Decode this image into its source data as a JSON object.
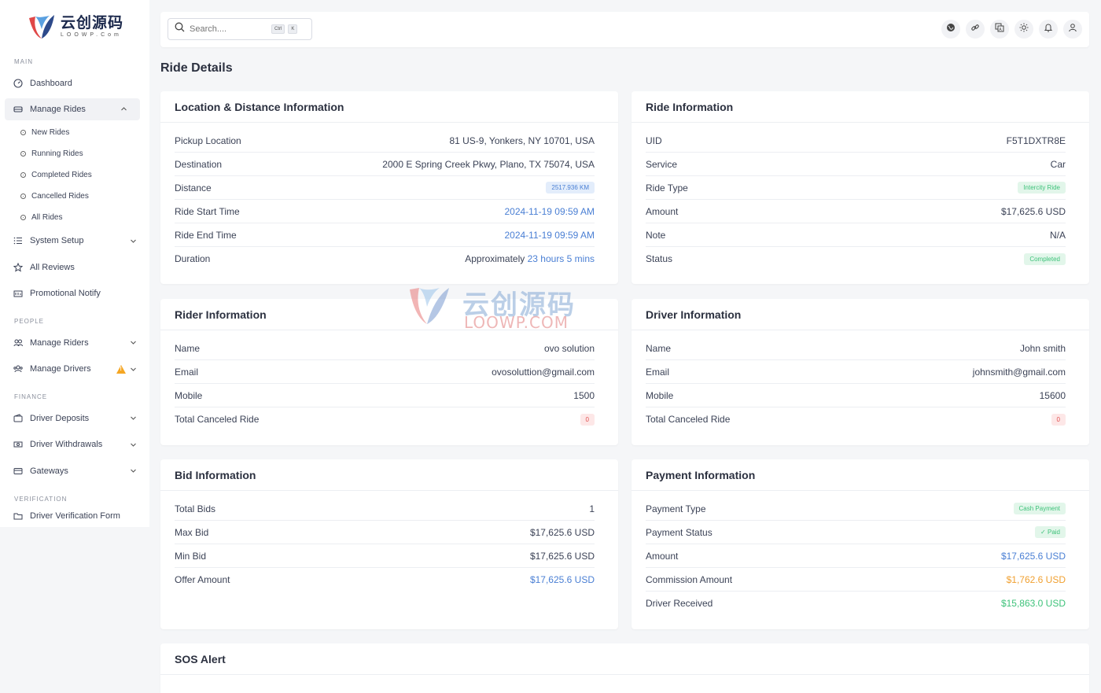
{
  "logo": {
    "cn": "云创源码",
    "en": "LOOWP.Com"
  },
  "sidebar": {
    "sections": {
      "main": "MAIN",
      "people": "PEOPLE",
      "finance": "FINANCE",
      "verification": "VERIFICATION"
    },
    "items": {
      "dashboard": "Dashboard",
      "manage_rides": "Manage Rides",
      "system_setup": "System Setup",
      "all_reviews": "All Reviews",
      "promotional_notify": "Promotional Notify",
      "manage_riders": "Manage Riders",
      "manage_drivers": "Manage Drivers",
      "driver_deposits": "Driver Deposits",
      "driver_withdrawals": "Driver Withdrawals",
      "gateways": "Gateways",
      "driver_verification_form": "Driver Verification Form"
    },
    "ride_sub": [
      "New Rides",
      "Running Rides",
      "Completed Rides",
      "Cancelled Rides",
      "All Rides"
    ]
  },
  "search": {
    "placeholder": "Search....",
    "kbd1": "Ctrl",
    "kbd2": "K"
  },
  "page_title": "Ride Details",
  "location": {
    "title": "Location & Distance Information",
    "pickup_label": "Pickup Location",
    "pickup": "81 US-9, Yonkers, NY 10701, USA",
    "dest_label": "Destination",
    "dest": "2000 E Spring Creek Pkwy, Plano, TX 75074, USA",
    "distance_label": "Distance",
    "distance": "2517.936 KM",
    "start_label": "Ride Start Time",
    "start": "2024-11-19 09:59 AM",
    "end_label": "Ride End Time",
    "end": "2024-11-19 09:59 AM",
    "duration_label": "Duration",
    "duration_prefix": "Approximately",
    "duration": "23 hours 5 mins"
  },
  "ride": {
    "title": "Ride Information",
    "uid_label": "UID",
    "uid": "F5T1DXTR8E",
    "service_label": "Service",
    "service": "Car",
    "type_label": "Ride Type",
    "type": "Intercity Ride",
    "amount_label": "Amount",
    "amount": "$17,625.6 USD",
    "note_label": "Note",
    "note": "N/A",
    "status_label": "Status",
    "status": "Completed"
  },
  "rider": {
    "title": "Rider Information",
    "name_label": "Name",
    "name": "ovo solution",
    "email_label": "Email",
    "email": "ovosoluttion@gmail.com",
    "mobile_label": "Mobile",
    "mobile": "1500",
    "canceled_label": "Total Canceled Ride",
    "canceled": "0"
  },
  "driver": {
    "title": "Driver Information",
    "name_label": "Name",
    "name": "John smith",
    "email_label": "Email",
    "email": "johnsmith@gmail.com",
    "mobile_label": "Mobile",
    "mobile": "15600",
    "canceled_label": "Total Canceled Ride",
    "canceled": "0"
  },
  "bid": {
    "title": "Bid Information",
    "total_label": "Total Bids",
    "total": "1",
    "max_label": "Max Bid",
    "max": "$17,625.6 USD",
    "min_label": "Min Bid",
    "min": "$17,625.6 USD",
    "offer_label": "Offer Amount",
    "offer": "$17,625.6 USD"
  },
  "payment": {
    "title": "Payment Information",
    "type_label": "Payment Type",
    "type": "Cash Payment",
    "status_label": "Payment Status",
    "status": "Paid",
    "amount_label": "Amount",
    "amount": "$17,625.6 USD",
    "commission_label": "Commission Amount",
    "commission": "$1,762.6 USD",
    "received_label": "Driver Received",
    "received": "$15,863.0 USD"
  },
  "sos": {
    "title": "SOS Alert"
  },
  "watermark": {
    "cn": "云创源码",
    "en": "LOOWP.COM"
  },
  "colors": {
    "accent": "#4a7fd4",
    "success": "#3ec27a",
    "warning": "#f0a030",
    "danger": "#e05050"
  }
}
